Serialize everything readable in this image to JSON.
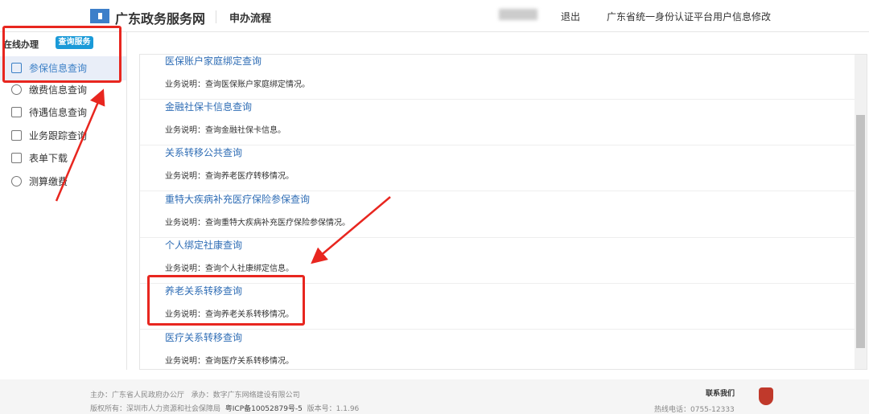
{
  "header": {
    "site_name": "广东政务服务网",
    "section": "申办流程",
    "logout": "退出",
    "profile_link": "广东省统一身份认证平台用户信息修改"
  },
  "sidebar": {
    "heading": "在线办理",
    "badge": "查询服务",
    "items": [
      {
        "label": "参保信息查询",
        "icon": "edit-doc-icon",
        "active": true
      },
      {
        "label": "缴费信息查询",
        "icon": "payment-icon"
      },
      {
        "label": "待遇信息查询",
        "icon": "document-icon"
      },
      {
        "label": "业务跟踪查询",
        "icon": "tracking-icon"
      },
      {
        "label": "表单下载",
        "icon": "form-icon"
      },
      {
        "label": "测算缴费",
        "icon": "calculator-icon"
      }
    ]
  },
  "main": {
    "items": [
      {
        "title": "医保账户家庭绑定查询",
        "desc": "业务说明：查询医保账户家庭绑定情况。"
      },
      {
        "title": "金融社保卡信息查询",
        "desc": "业务说明：查询金融社保卡信息。"
      },
      {
        "title": "关系转移公共查询",
        "desc": "业务说明：查询养老医疗转移情况。"
      },
      {
        "title": "重特大疾病补充医疗保险参保查询",
        "desc": "业务说明：查询重特大疾病补充医疗保险参保情况。"
      },
      {
        "title": "个人绑定社康查询",
        "desc": "业务说明：查询个人社康绑定信息。"
      },
      {
        "title": "养老关系转移查询",
        "desc": "业务说明：查询养老关系转移情况。"
      },
      {
        "title": "医疗关系转移查询",
        "desc": "业务说明：查询医疗关系转移情况。"
      }
    ]
  },
  "footer": {
    "host": "主办：广东省人民政府办公厅",
    "undertaker": "承办：数字广东网络建设有限公司",
    "copyright": "版权所有：深圳市人力资源和社会保障局",
    "icp": "粤ICP备10052879号-5",
    "version": "版本号：1.1.96",
    "contact": "联系我们",
    "hotline": "热线电话：0755-12333"
  },
  "colors": {
    "accent": "#1a9ad8",
    "link": "#2f6db5",
    "annotation": "#e8261f"
  }
}
